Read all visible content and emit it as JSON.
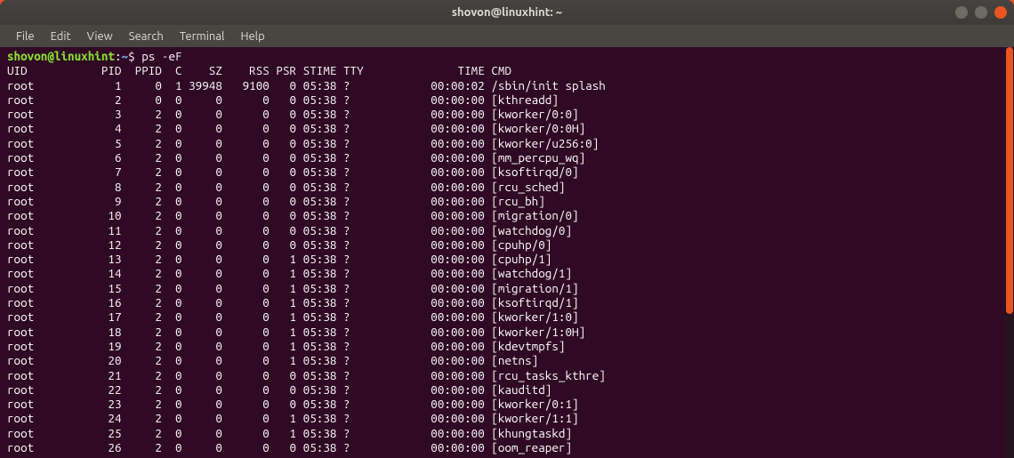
{
  "titlebar": {
    "title": "shovon@linuxhint: ~"
  },
  "menubar": {
    "items": [
      "File",
      "Edit",
      "View",
      "Search",
      "Terminal",
      "Help"
    ]
  },
  "prompt": {
    "user_host": "shovon@linuxhint",
    "colon": ":",
    "path": "~",
    "dollar": "$ ",
    "command": "ps -eF"
  },
  "columns": [
    "UID",
    "PID",
    "PPID",
    "C",
    "SZ",
    "RSS",
    "PSR",
    "STIME",
    "TTY",
    "TIME",
    "CMD"
  ],
  "rows": [
    {
      "uid": "root",
      "pid": "1",
      "ppid": "0",
      "c": "1",
      "sz": "39948",
      "rss": "9100",
      "psr": "0",
      "stime": "05:38",
      "tty": "?",
      "time": "00:00:02",
      "cmd": "/sbin/init splash"
    },
    {
      "uid": "root",
      "pid": "2",
      "ppid": "0",
      "c": "0",
      "sz": "0",
      "rss": "0",
      "psr": "0",
      "stime": "05:38",
      "tty": "?",
      "time": "00:00:00",
      "cmd": "[kthreadd]"
    },
    {
      "uid": "root",
      "pid": "3",
      "ppid": "2",
      "c": "0",
      "sz": "0",
      "rss": "0",
      "psr": "0",
      "stime": "05:38",
      "tty": "?",
      "time": "00:00:00",
      "cmd": "[kworker/0:0]"
    },
    {
      "uid": "root",
      "pid": "4",
      "ppid": "2",
      "c": "0",
      "sz": "0",
      "rss": "0",
      "psr": "0",
      "stime": "05:38",
      "tty": "?",
      "time": "00:00:00",
      "cmd": "[kworker/0:0H]"
    },
    {
      "uid": "root",
      "pid": "5",
      "ppid": "2",
      "c": "0",
      "sz": "0",
      "rss": "0",
      "psr": "0",
      "stime": "05:38",
      "tty": "?",
      "time": "00:00:00",
      "cmd": "[kworker/u256:0]"
    },
    {
      "uid": "root",
      "pid": "6",
      "ppid": "2",
      "c": "0",
      "sz": "0",
      "rss": "0",
      "psr": "0",
      "stime": "05:38",
      "tty": "?",
      "time": "00:00:00",
      "cmd": "[mm_percpu_wq]"
    },
    {
      "uid": "root",
      "pid": "7",
      "ppid": "2",
      "c": "0",
      "sz": "0",
      "rss": "0",
      "psr": "0",
      "stime": "05:38",
      "tty": "?",
      "time": "00:00:00",
      "cmd": "[ksoftirqd/0]"
    },
    {
      "uid": "root",
      "pid": "8",
      "ppid": "2",
      "c": "0",
      "sz": "0",
      "rss": "0",
      "psr": "0",
      "stime": "05:38",
      "tty": "?",
      "time": "00:00:00",
      "cmd": "[rcu_sched]"
    },
    {
      "uid": "root",
      "pid": "9",
      "ppid": "2",
      "c": "0",
      "sz": "0",
      "rss": "0",
      "psr": "0",
      "stime": "05:38",
      "tty": "?",
      "time": "00:00:00",
      "cmd": "[rcu_bh]"
    },
    {
      "uid": "root",
      "pid": "10",
      "ppid": "2",
      "c": "0",
      "sz": "0",
      "rss": "0",
      "psr": "0",
      "stime": "05:38",
      "tty": "?",
      "time": "00:00:00",
      "cmd": "[migration/0]"
    },
    {
      "uid": "root",
      "pid": "11",
      "ppid": "2",
      "c": "0",
      "sz": "0",
      "rss": "0",
      "psr": "0",
      "stime": "05:38",
      "tty": "?",
      "time": "00:00:00",
      "cmd": "[watchdog/0]"
    },
    {
      "uid": "root",
      "pid": "12",
      "ppid": "2",
      "c": "0",
      "sz": "0",
      "rss": "0",
      "psr": "0",
      "stime": "05:38",
      "tty": "?",
      "time": "00:00:00",
      "cmd": "[cpuhp/0]"
    },
    {
      "uid": "root",
      "pid": "13",
      "ppid": "2",
      "c": "0",
      "sz": "0",
      "rss": "0",
      "psr": "1",
      "stime": "05:38",
      "tty": "?",
      "time": "00:00:00",
      "cmd": "[cpuhp/1]"
    },
    {
      "uid": "root",
      "pid": "14",
      "ppid": "2",
      "c": "0",
      "sz": "0",
      "rss": "0",
      "psr": "1",
      "stime": "05:38",
      "tty": "?",
      "time": "00:00:00",
      "cmd": "[watchdog/1]"
    },
    {
      "uid": "root",
      "pid": "15",
      "ppid": "2",
      "c": "0",
      "sz": "0",
      "rss": "0",
      "psr": "1",
      "stime": "05:38",
      "tty": "?",
      "time": "00:00:00",
      "cmd": "[migration/1]"
    },
    {
      "uid": "root",
      "pid": "16",
      "ppid": "2",
      "c": "0",
      "sz": "0",
      "rss": "0",
      "psr": "1",
      "stime": "05:38",
      "tty": "?",
      "time": "00:00:00",
      "cmd": "[ksoftirqd/1]"
    },
    {
      "uid": "root",
      "pid": "17",
      "ppid": "2",
      "c": "0",
      "sz": "0",
      "rss": "0",
      "psr": "1",
      "stime": "05:38",
      "tty": "?",
      "time": "00:00:00",
      "cmd": "[kworker/1:0]"
    },
    {
      "uid": "root",
      "pid": "18",
      "ppid": "2",
      "c": "0",
      "sz": "0",
      "rss": "0",
      "psr": "1",
      "stime": "05:38",
      "tty": "?",
      "time": "00:00:00",
      "cmd": "[kworker/1:0H]"
    },
    {
      "uid": "root",
      "pid": "19",
      "ppid": "2",
      "c": "0",
      "sz": "0",
      "rss": "0",
      "psr": "1",
      "stime": "05:38",
      "tty": "?",
      "time": "00:00:00",
      "cmd": "[kdevtmpfs]"
    },
    {
      "uid": "root",
      "pid": "20",
      "ppid": "2",
      "c": "0",
      "sz": "0",
      "rss": "0",
      "psr": "1",
      "stime": "05:38",
      "tty": "?",
      "time": "00:00:00",
      "cmd": "[netns]"
    },
    {
      "uid": "root",
      "pid": "21",
      "ppid": "2",
      "c": "0",
      "sz": "0",
      "rss": "0",
      "psr": "0",
      "stime": "05:38",
      "tty": "?",
      "time": "00:00:00",
      "cmd": "[rcu_tasks_kthre]"
    },
    {
      "uid": "root",
      "pid": "22",
      "ppid": "2",
      "c": "0",
      "sz": "0",
      "rss": "0",
      "psr": "0",
      "stime": "05:38",
      "tty": "?",
      "time": "00:00:00",
      "cmd": "[kauditd]"
    },
    {
      "uid": "root",
      "pid": "23",
      "ppid": "2",
      "c": "0",
      "sz": "0",
      "rss": "0",
      "psr": "0",
      "stime": "05:38",
      "tty": "?",
      "time": "00:00:00",
      "cmd": "[kworker/0:1]"
    },
    {
      "uid": "root",
      "pid": "24",
      "ppid": "2",
      "c": "0",
      "sz": "0",
      "rss": "0",
      "psr": "1",
      "stime": "05:38",
      "tty": "?",
      "time": "00:00:00",
      "cmd": "[kworker/1:1]"
    },
    {
      "uid": "root",
      "pid": "25",
      "ppid": "2",
      "c": "0",
      "sz": "0",
      "rss": "0",
      "psr": "1",
      "stime": "05:38",
      "tty": "?",
      "time": "00:00:00",
      "cmd": "[khungtaskd]"
    },
    {
      "uid": "root",
      "pid": "26",
      "ppid": "2",
      "c": "0",
      "sz": "0",
      "rss": "0",
      "psr": "0",
      "stime": "05:38",
      "tty": "?",
      "time": "00:00:00",
      "cmd": "[oom_reaper]"
    }
  ]
}
